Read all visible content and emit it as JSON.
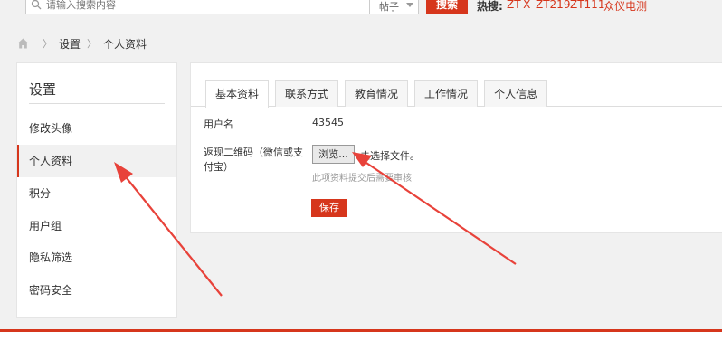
{
  "search": {
    "placeholder": "请输入搜索内容",
    "type_label": "帖子",
    "button_label": "搜索"
  },
  "hot": {
    "label": "热搜:",
    "links": [
      "ZT-X",
      "ZT219",
      "ZT111",
      "众仪电测"
    ]
  },
  "breadcrumb": {
    "items": [
      "设置",
      "个人资料"
    ]
  },
  "sidebar": {
    "title": "设置",
    "items": [
      {
        "label": "修改头像"
      },
      {
        "label": "个人资料"
      },
      {
        "label": "积分"
      },
      {
        "label": "用户组"
      },
      {
        "label": "隐私筛选"
      },
      {
        "label": "密码安全"
      }
    ],
    "active_index": 1
  },
  "tabs": [
    {
      "label": "基本资料"
    },
    {
      "label": "联系方式"
    },
    {
      "label": "教育情况"
    },
    {
      "label": "工作情况"
    },
    {
      "label": "个人信息"
    }
  ],
  "form": {
    "username_label": "用户名",
    "username_value": "43545",
    "qrcode_label_line1": "返现二维码（微信或支",
    "qrcode_label_line2": "付宝）",
    "browse_label": "浏览...",
    "no_file_text": "未选择文件。",
    "hint_text": "此项资料提交后需要审核",
    "save_label": "保存"
  },
  "colors": {
    "accent": "#d6361c",
    "arrow": "#e8423a"
  }
}
